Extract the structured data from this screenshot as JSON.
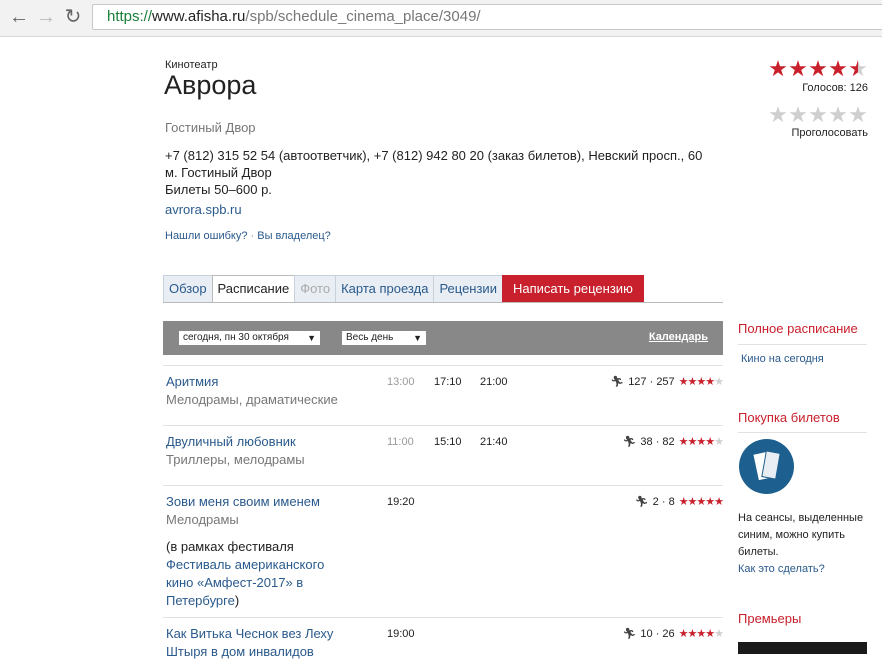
{
  "browser": {
    "url_scheme": "https://",
    "url_host": "www.afisha.ru",
    "url_path": "/spb/schedule_cinema_place/3049/"
  },
  "venue": {
    "kicker": "Кинотеатр",
    "title": "Аврора",
    "district": "Гостиный Двор",
    "contacts_line1": "+7 (812) 315 52 54 (автоответчик), +7 (812) 942 80 20 (заказ билетов), Невский просп., 60",
    "contacts_line2": "м. Гостиный Двор",
    "contacts_line3": "Билеты 50–600 р.",
    "website": "avrora.spb.ru",
    "report_error": "Нашли ошибку?",
    "report_sep": "·",
    "owner_link": "Вы владелец?"
  },
  "rating": {
    "stars_value": 4.5,
    "votes_text": "Голосов: 126",
    "vote_link": "Проголосовать"
  },
  "tabs": [
    {
      "label": "Обзор",
      "state": "normal"
    },
    {
      "label": "Расписание",
      "state": "active"
    },
    {
      "label": "Фото",
      "state": "disabled"
    },
    {
      "label": "Карта проезда",
      "state": "normal"
    },
    {
      "label": "Рецензии",
      "state": "normal"
    },
    {
      "label": "Написать рецензию",
      "state": "red"
    }
  ],
  "filter": {
    "date_value": "сегодня, пн 30 октября",
    "period_value": "Весь день",
    "calendar_link": "Календарь"
  },
  "films": [
    {
      "title": "Аритмия",
      "genre": "Мелодрамы, драматические",
      "times": [
        "13:00",
        "17:10",
        "21:00"
      ],
      "past_count": 1,
      "rating_text": "127 · 257",
      "stars": 4.5
    },
    {
      "title": "Двуличный любовник",
      "genre": "Триллеры, мелодрамы",
      "times": [
        "11:00",
        "15:10",
        "21:40"
      ],
      "past_count": 1,
      "rating_text": "38 · 82",
      "stars": 4.5
    },
    {
      "title": "Зови меня своим именем",
      "genre": "Мелодрамы",
      "times": [
        "19:20"
      ],
      "past_count": 0,
      "rating_text": "2 · 8",
      "stars": 5,
      "note_prefix": "(в рамках фестиваля",
      "note_link": "Фестиваль американского кино «Амфест-2017» в Петербурге",
      "note_suffix": ")"
    },
    {
      "title": "Как Витька Чеснок вез Леху Штыря в дом инвалидов",
      "genre": "",
      "times": [
        "19:00"
      ],
      "past_count": 0,
      "rating_text": "10 · 26",
      "stars": 4.5
    }
  ],
  "sidebar": {
    "full_schedule_heading": "Полное расписание",
    "today_link": "Кино на сегодня",
    "tickets_heading": "Покупка билетов",
    "tickets_text": "На сеансы, выделенные синим, можно купить билеты.",
    "how_link": "Как это сделать?",
    "premieres_heading": "Премьеры"
  },
  "colors": {
    "accent_red": "#c8202c",
    "link_blue": "#2a5a8c",
    "filter_bar": "#888888"
  }
}
